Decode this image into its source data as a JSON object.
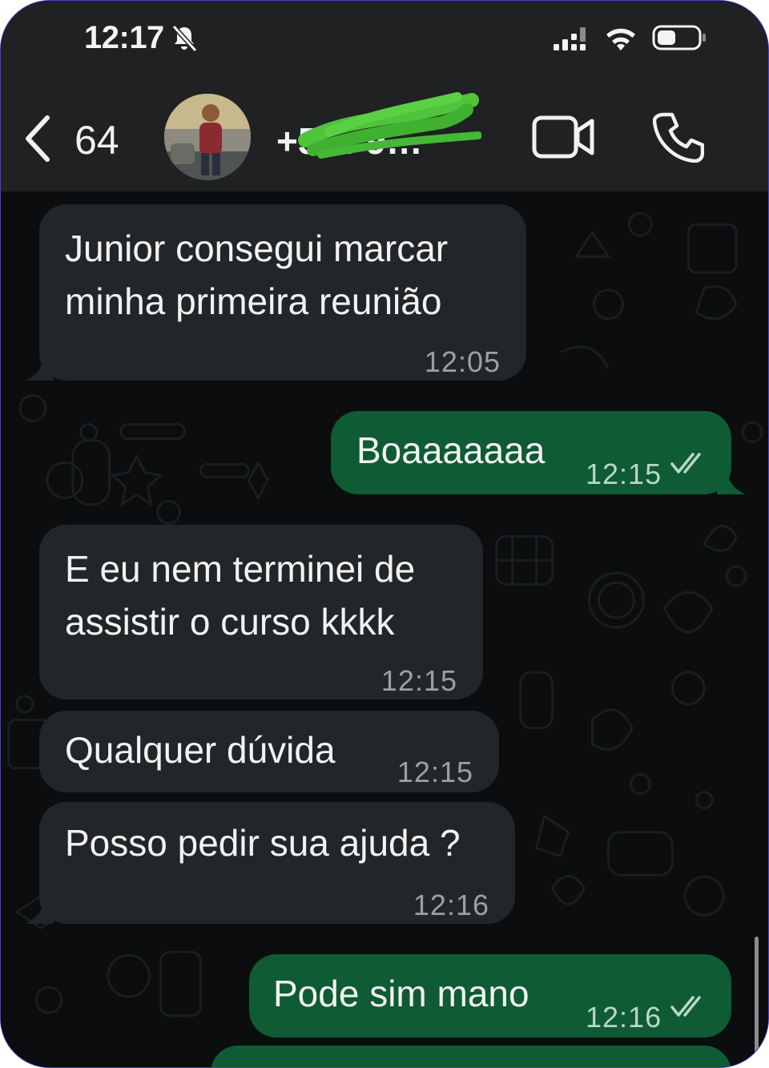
{
  "status_bar": {
    "time": "12:17",
    "icons": [
      "bell-slash-icon",
      "signal-icon",
      "wifi-icon",
      "battery-icon"
    ]
  },
  "header": {
    "back_icon": "chevron-left-icon",
    "unread_count": "64",
    "contact_name": "+5… 9…",
    "video_icon": "video-camera-icon",
    "call_icon": "phone-icon"
  },
  "messages": [
    {
      "direction": "incoming",
      "lines": [
        "Junior consegui marcar",
        "minha primeira reunião"
      ],
      "time": "12:05"
    },
    {
      "direction": "outgoing",
      "lines": [
        "Boaaaaaaa"
      ],
      "time": "12:15",
      "status": "read"
    },
    {
      "direction": "incoming",
      "lines": [
        "E eu nem terminei de",
        "assistir o curso kkkk"
      ],
      "time": "12:15"
    },
    {
      "direction": "incoming",
      "lines": [
        "Qualquer dúvida"
      ],
      "time": "12:15"
    },
    {
      "direction": "incoming",
      "lines": [
        "Posso pedir sua ajuda ?"
      ],
      "time": "12:16"
    },
    {
      "direction": "outgoing",
      "lines": [
        "Pode sim mano"
      ],
      "time": "12:16",
      "status": "read"
    }
  ],
  "colors": {
    "header_bg": "#1f2122",
    "chat_bg": "#0b0d0e",
    "incoming_bubble": "#232628",
    "outgoing_bubble": "#0f5b34",
    "read_ticks": "#b8d7c5"
  }
}
